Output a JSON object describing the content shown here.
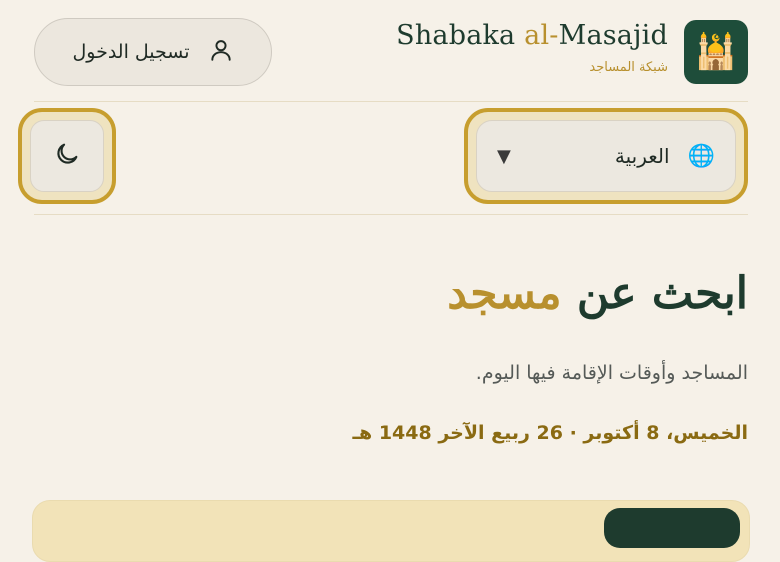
{
  "brand": {
    "name_part1": "Shabaka ",
    "name_accent": "al-",
    "name_part2": "Masajid",
    "subtitle_ar": "شبكة المساجد",
    "logo_icon": "mosque-icon",
    "logo_glyph": "🕌"
  },
  "header": {
    "login_label": "تسجيل الدخول",
    "login_icon": "user-icon"
  },
  "controls": {
    "language_selected": "العربية",
    "language_icon": "globe-icon",
    "language_glyph": "🌐",
    "dropdown_caret": "▼",
    "theme_icon": "moon-icon"
  },
  "hero": {
    "title_part1": "ابحث عن ",
    "title_accent": "مسجد",
    "subtitle": "المساجد وأوقات الإقامة فيها اليوم.",
    "date": "الخميس، 8 أكتوبر · 26 ربيع الآخر 1448 هـ"
  },
  "colors": {
    "primary": "#1e3b2e",
    "accent": "#b8902e",
    "background": "#f6f1e8"
  }
}
